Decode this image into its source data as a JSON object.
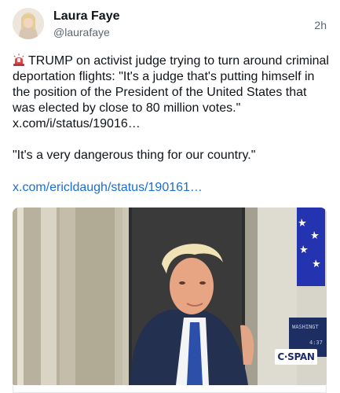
{
  "post": {
    "author": {
      "name": "Laura Faye",
      "handle": "@laurafaye"
    },
    "timestamp": "2h",
    "icons": {
      "alert": "police-car-light-icon"
    },
    "text_line1": "TRUMP on activist judge trying to turn around criminal deportation flights: \"It's a judge that's putting himself in the position of the President of the United States that was elected by close to 80 million votes.\"",
    "text_link1": "x.com/i/status/19016…",
    "text_para2": "\"It's a very dangerous thing for our country.\"",
    "link2": "x.com/ericldaugh/status/190161…",
    "media": {
      "bug": "C·SPAN",
      "monitor_top": "WASHINGT",
      "monitor_bottom": "4:37"
    },
    "colors": {
      "link": "#1a6ed8",
      "muted": "#5b6672",
      "text": "#0f1419"
    }
  }
}
